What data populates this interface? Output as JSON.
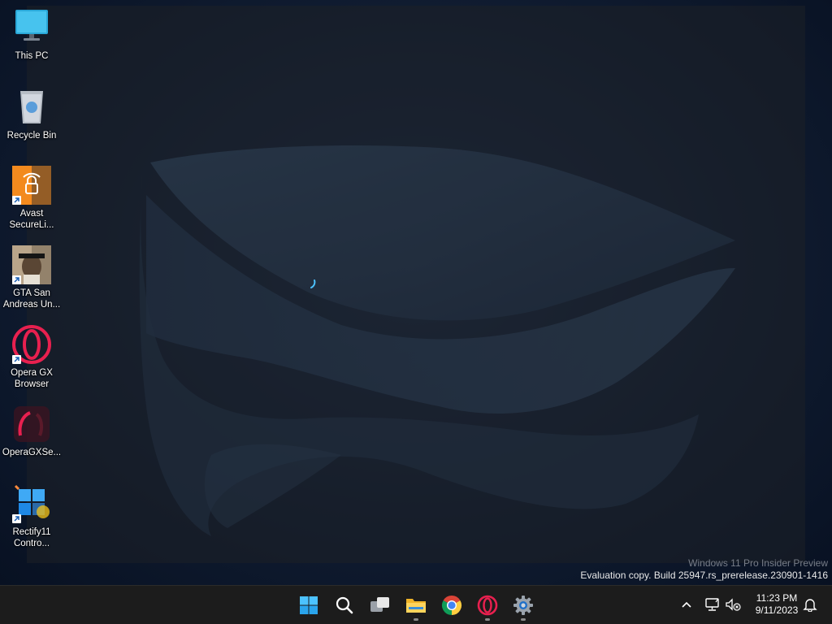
{
  "desktop": {
    "icons": [
      {
        "label": "This PC",
        "icon": "monitor-icon",
        "shortcut": false
      },
      {
        "label": "Recycle Bin",
        "icon": "recycle-bin-icon",
        "shortcut": false
      },
      {
        "label": "Avast SecureLi...",
        "icon": "avast-secureline-icon",
        "shortcut": true
      },
      {
        "label": "GTA San Andreas Un...",
        "icon": "gta-san-andreas-icon",
        "shortcut": true
      },
      {
        "label": "Opera GX Browser",
        "icon": "opera-gx-icon",
        "shortcut": true
      },
      {
        "label": "OperaGXSe...",
        "icon": "opera-gx-setup-icon",
        "shortcut": false
      },
      {
        "label": "Rectify11 Contro...",
        "icon": "rectify11-control-icon",
        "shortcut": true
      }
    ],
    "watermark": {
      "line1": "Windows 11 Pro Insider Preview",
      "line2": "Evaluation copy. Build 25947.rs_prerelease.230901-1416"
    }
  },
  "taskbar": {
    "apps": [
      {
        "name": "start-button",
        "icon": "windows-logo-icon",
        "running": false
      },
      {
        "name": "search-button",
        "icon": "search-icon",
        "running": false
      },
      {
        "name": "task-view-button",
        "icon": "task-view-icon",
        "running": false
      },
      {
        "name": "file-explorer-button",
        "icon": "folder-icon",
        "running": true
      },
      {
        "name": "chrome-button",
        "icon": "chrome-icon",
        "running": false
      },
      {
        "name": "opera-gx-button",
        "icon": "opera-icon",
        "running": true
      },
      {
        "name": "settings-button",
        "icon": "gear-icon",
        "running": true
      }
    ],
    "tray": {
      "icons": [
        "chevron-up-icon",
        "network-icon",
        "volume-muted-icon",
        "notification-bell-icon"
      ],
      "time": "11:23 PM",
      "date": "9/11/2023"
    }
  },
  "colors": {
    "taskbar": "#1c1c1c",
    "accent": "#4cc2ff"
  }
}
